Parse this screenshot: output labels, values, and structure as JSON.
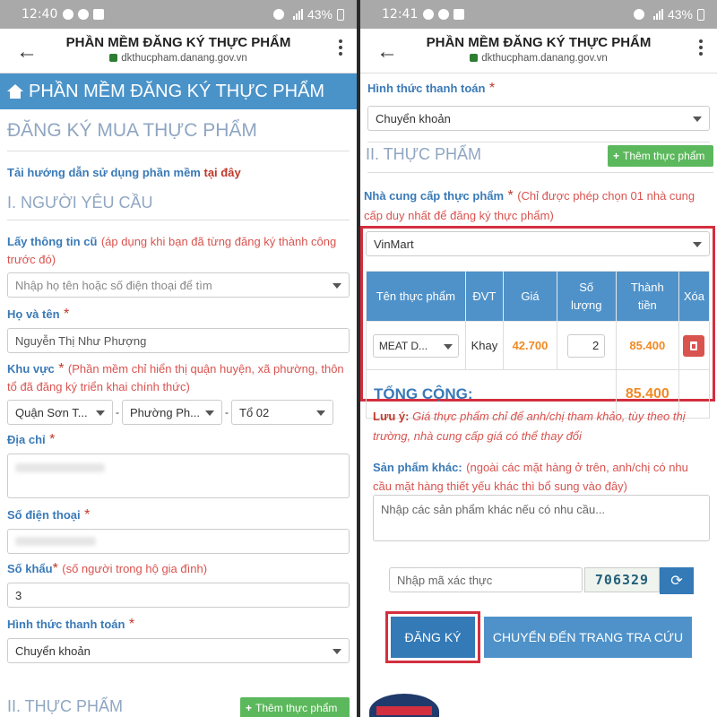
{
  "status_left": {
    "time": "12:40",
    "battery": "43%"
  },
  "status_right": {
    "time": "12:41",
    "battery": "43%"
  },
  "browser": {
    "title": "PHẦN MỀM ĐĂNG KÝ THỰC PHẨM",
    "url": "dkthucpham.danang.gov.vn"
  },
  "left": {
    "banner": "PHẦN MỀM ĐĂNG KÝ THỰC PHẨM",
    "page_heading": "ĐĂNG KÝ MUA THỰC PHẨM",
    "guide_text": "Tải hướng dẫn sử dụng phần mềm",
    "guide_link": "tại đây",
    "section1": "I. NGƯỜI YÊU CẦU",
    "prev_info_label": "Lấy thông tin cũ",
    "prev_info_note": "(áp dụng khi bạn đã từng đăng ký thành công trước đó)",
    "prev_info_placeholder": "Nhập họ tên hoặc số điện thoại để tìm",
    "fullname_label": "Họ và tên",
    "fullname_value": "Nguyễn Thị Như Phượng",
    "area_label": "Khu vực",
    "area_note": "(Phần mềm chỉ hiển thị quận huyện, xã phường, thôn tổ đã đăng ký triển khai chính thức)",
    "district": "Quận Sơn T...",
    "ward": "Phường Ph...",
    "group": "Tổ 02",
    "address_label": "Địa chỉ",
    "phone_label": "Số điện thoại",
    "household_label": "Số khẩu",
    "household_note": "(số người trong hộ gia đình)",
    "household_value": "3",
    "payment_label": "Hình thức thanh toán",
    "payment_value": "Chuyển khoản",
    "section2": "II. THỰC PHẨM",
    "add_food_button": "Thêm thực phẩm"
  },
  "right": {
    "payment_label": "Hình thức thanh toán",
    "payment_value": "Chuyển khoản",
    "section2": "II. THỰC PHẨM",
    "add_food_button": "Thêm thực phẩm",
    "supplier_label": "Nhà cung cấp thực phẩm",
    "supplier_note": "(Chỉ được phép chọn 01 nhà cung cấp duy nhất để đăng ký thực phẩm)",
    "supplier_value": "VinMart",
    "table": {
      "headers": {
        "name": "Tên thực phẩm",
        "unit": "ĐVT",
        "price": "Giá",
        "qty_l1": "Số",
        "qty_l2": "lượng",
        "total_l1": "Thành",
        "total_l2": "tiền",
        "delete": "Xóa"
      },
      "row": {
        "name": "MEAT D...",
        "unit": "Khay",
        "price": "42.700",
        "qty": "2",
        "total": "85.400"
      },
      "grand_label": "TỔNG CỘNG:",
      "grand_total": "85.400"
    },
    "note_label": "Lưu ý:",
    "note_text": "Giá thực phẩm chỉ để anh/chị tham khảo, tùy theo thị trường, nhà cung cấp giá có thể thay đổi",
    "other_label": "Sản phẩm khác:",
    "other_note": "(ngoài các mặt hàng ở trên, anh/chị có nhu cầu mặt hàng thiết yếu khác thì bổ sung vào đây)",
    "other_placeholder": "Nhập các sản phẩm khác nếu có nhu cầu...",
    "captcha_placeholder": "Nhập mã xác thực",
    "captcha_code": "706329",
    "register_button": "ĐĂNG KÝ",
    "lookup_button": "CHUYỂN ĐẾN TRANG TRA CỨU"
  },
  "colors": {
    "banner": "#4a93c9",
    "label_blue": "#3a7ab7",
    "note_red": "#d9534f",
    "highlight_red": "#d32f3f",
    "price_orange": "#f08a24",
    "success_green": "#5cb85c"
  }
}
